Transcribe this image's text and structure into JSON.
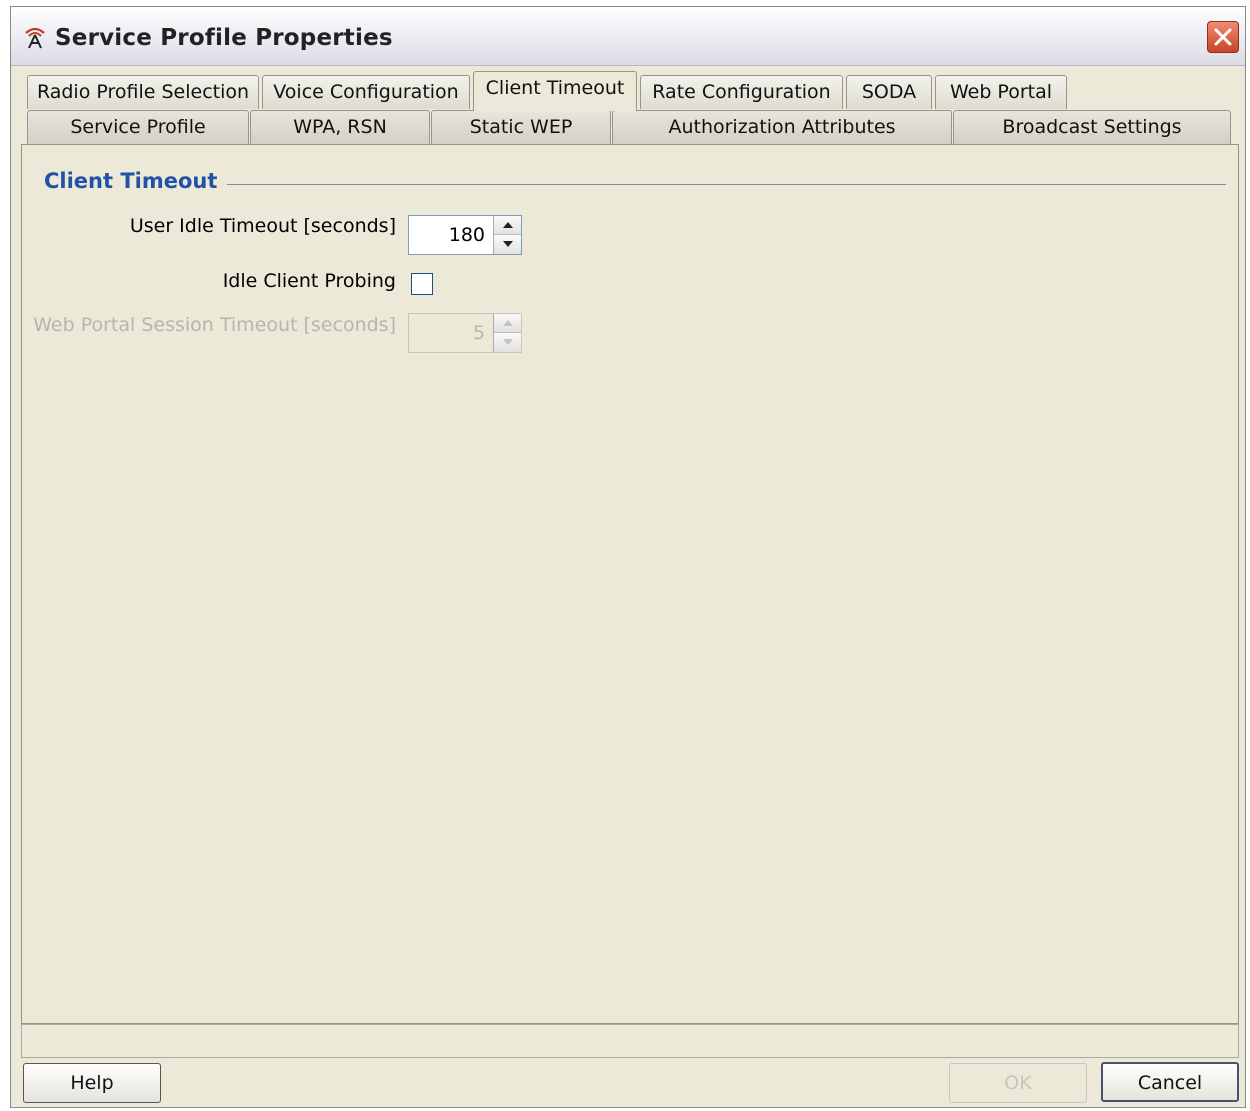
{
  "window": {
    "title": "Service Profile Properties"
  },
  "tabs": {
    "row1": [
      {
        "label": "Radio Profile Selection",
        "active": false
      },
      {
        "label": "Voice Configuration",
        "active": false
      },
      {
        "label": "Client Timeout",
        "active": true
      },
      {
        "label": "Rate Configuration",
        "active": false
      },
      {
        "label": "SODA",
        "active": false
      },
      {
        "label": "Web Portal",
        "active": false
      }
    ],
    "row2": [
      {
        "label": "Service Profile"
      },
      {
        "label": "WPA, RSN"
      },
      {
        "label": "Static WEP"
      },
      {
        "label": "Authorization Attributes"
      },
      {
        "label": "Broadcast Settings"
      }
    ]
  },
  "section": {
    "title": "Client Timeout"
  },
  "fields": {
    "user_idle_timeout": {
      "label": "User Idle Timeout [seconds]",
      "value": "180",
      "enabled": true
    },
    "idle_client_probing": {
      "label": "Idle Client Probing",
      "checked": false
    },
    "web_portal_session_timeout": {
      "label": "Web Portal Session Timeout [seconds]",
      "value": "5",
      "enabled": false
    }
  },
  "buttons": {
    "help": "Help",
    "ok": "OK",
    "cancel": "Cancel"
  },
  "colors": {
    "section_title": "#2152a8",
    "panel_background": "#ece9d8",
    "close_button": "#d45a3c"
  },
  "icons": {
    "app": "antenna-icon",
    "close": "close-icon"
  }
}
